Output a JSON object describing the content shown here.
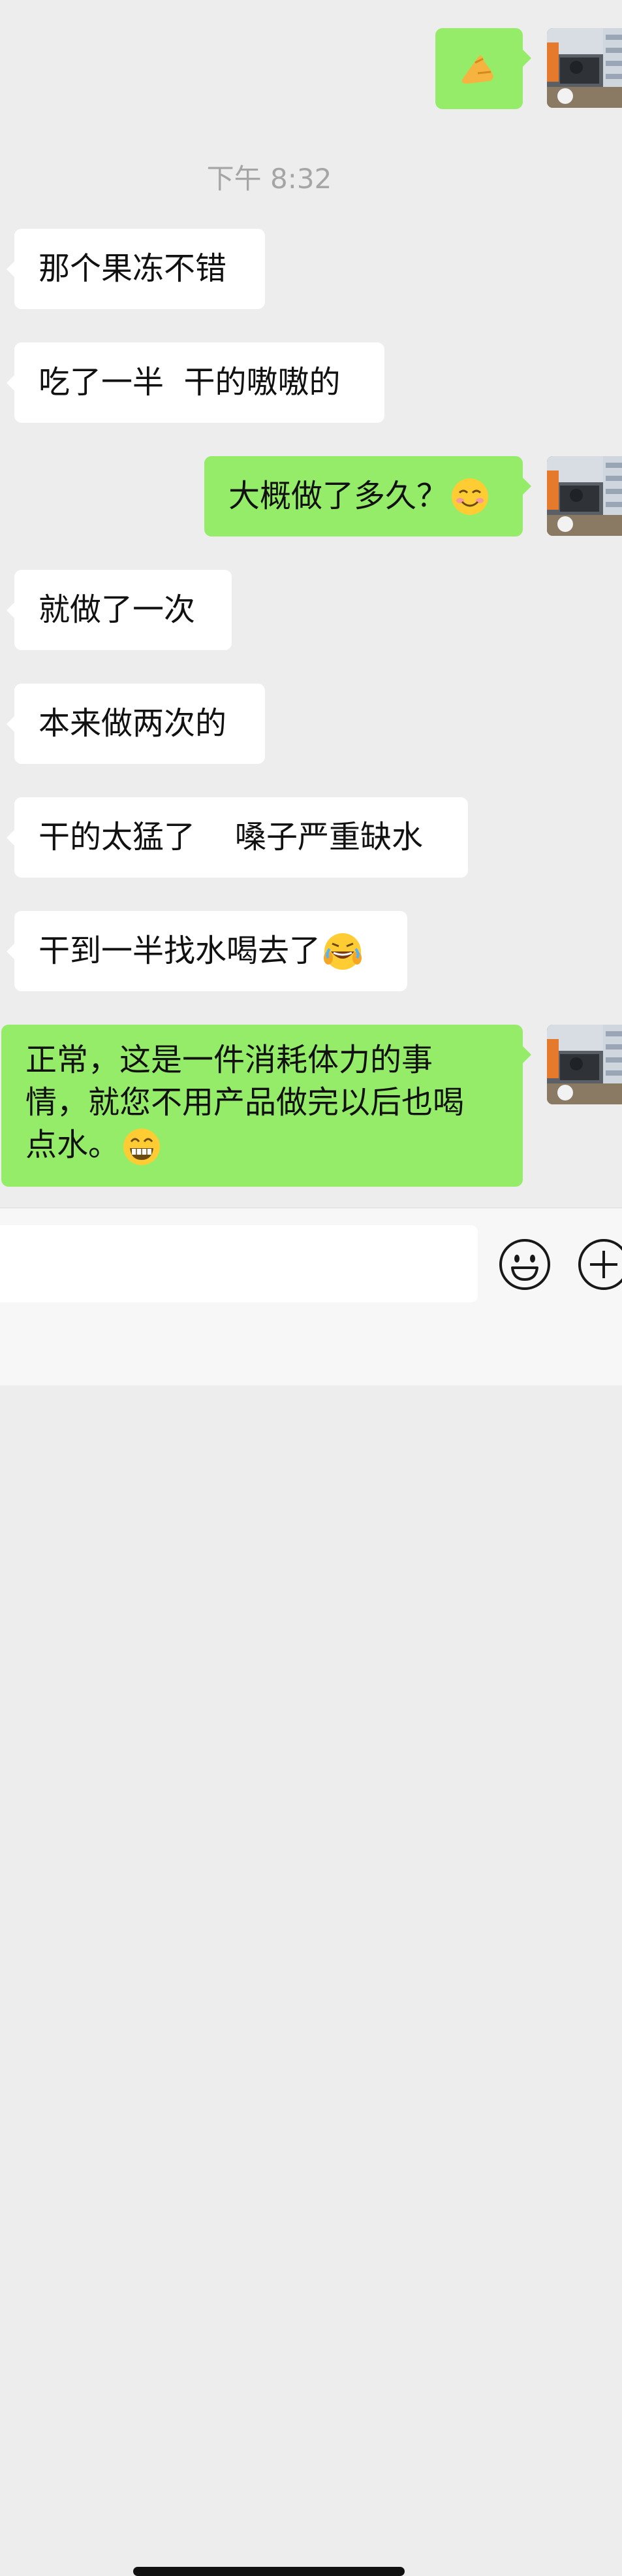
{
  "chat": {
    "timestamp": "下午 8:32",
    "messages": [
      {
        "from": "me",
        "text": "",
        "emoji": "pinching-hand-emoji"
      },
      {
        "from": "other",
        "text": "那个果冻不错"
      },
      {
        "from": "other",
        "text": "吃了一半  干的嗷嗷的"
      },
      {
        "from": "me",
        "text": "大概做了多久？",
        "emoji": "smiling-face-emoji"
      },
      {
        "from": "other",
        "text": "就做了一次"
      },
      {
        "from": "other",
        "text": "本来做两次的"
      },
      {
        "from": "other",
        "text": "干的太猛了    嗓子严重缺水"
      },
      {
        "from": "other",
        "text": "干到一半找水喝去了",
        "emoji": "rolling-laugh-emoji"
      },
      {
        "from": "me",
        "lines": [
          "正常，这是一件消耗体力的事",
          "情，就您不用产品做完以后也喝",
          "点水。"
        ],
        "emoji": "grinning-face-emoji"
      }
    ]
  },
  "input": {
    "value": "",
    "emoji_button": "emoji-icon",
    "more_button": "plus-icon"
  },
  "colors": {
    "background": "#ededed",
    "outgoing_bubble": "#95ec69",
    "incoming_bubble": "#ffffff",
    "timestamp_text": "#a5a5a5"
  }
}
